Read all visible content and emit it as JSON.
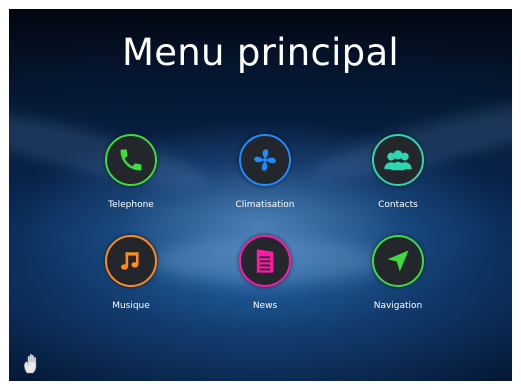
{
  "title": "Menu principal",
  "tiles": [
    {
      "label": "Telephone",
      "icon": "phone-icon",
      "ring": "#3fdc3f",
      "glyph": "#3fdc3f"
    },
    {
      "label": "Climatisation",
      "icon": "fan-icon",
      "ring": "#1e8cff",
      "glyph": "#1e8cff"
    },
    {
      "label": "Contacts",
      "icon": "contacts-icon",
      "ring": "#2fd6b2",
      "glyph": "#2fd6b2"
    },
    {
      "label": "Musique",
      "icon": "music-note-icon",
      "ring": "#ff8a1e",
      "glyph": "#ff8a1e"
    },
    {
      "label": "News",
      "icon": "newspaper-icon",
      "ring": "#ff1aa6",
      "glyph": "#ff1aa6"
    },
    {
      "label": "Navigation",
      "icon": "navigation-arrow-icon",
      "ring": "#3fdc3f",
      "glyph": "#3fdc3f"
    }
  ],
  "footer": {
    "icon": "hand-cursor-icon"
  }
}
